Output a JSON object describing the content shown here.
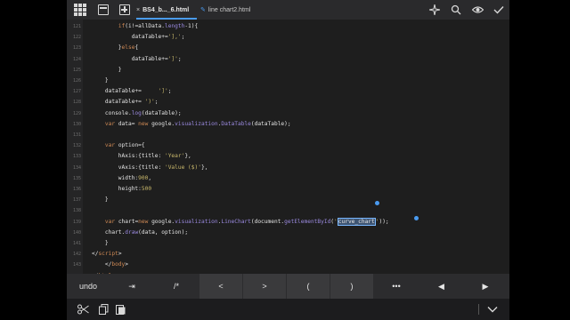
{
  "tabs": [
    {
      "label": "BS4_b..._6.html",
      "active": true
    },
    {
      "label": "line chart2.html",
      "active": false
    }
  ],
  "toolbar": {
    "icons": [
      "grid-icon",
      "folder-icon",
      "plus-icon",
      "sparkle-icon",
      "search-icon",
      "eye-icon",
      "checkmark-icon"
    ],
    "close_glyph": "×",
    "edit_glyph": "✎"
  },
  "editor": {
    "lines": [
      {
        "n": "121",
        "segs": [
          [
            "",
            "        "
          ],
          [
            "kw",
            "if"
          ],
          [
            "",
            "(i!=allData."
          ],
          [
            "fn",
            "length"
          ],
          [
            "",
            "-1){"
          ]
        ]
      },
      {
        "n": "122",
        "segs": [
          [
            "",
            "            dataTable+="
          ],
          [
            "str",
            "'],'"
          ],
          [
            "",
            ";"
          ]
        ]
      },
      {
        "n": "123",
        "segs": [
          [
            "",
            "        }"
          ],
          [
            "kw",
            "else"
          ],
          [
            "",
            "{"
          ]
        ]
      },
      {
        "n": "124",
        "segs": [
          [
            "",
            "            dataTable+="
          ],
          [
            "str",
            "']'"
          ],
          [
            "",
            ";"
          ]
        ]
      },
      {
        "n": "125",
        "segs": [
          [
            "",
            "        }"
          ]
        ]
      },
      {
        "n": "126",
        "segs": [
          [
            "",
            "    }"
          ]
        ]
      },
      {
        "n": "127",
        "segs": [
          [
            "",
            "    dataTable+=     "
          ],
          [
            "str",
            "']'"
          ],
          [
            "",
            ";"
          ]
        ]
      },
      {
        "n": "128",
        "segs": [
          [
            "",
            "    dataTable+= "
          ],
          [
            "str",
            "')'"
          ],
          [
            "",
            ";"
          ]
        ]
      },
      {
        "n": "129",
        "segs": [
          [
            "",
            "    console."
          ],
          [
            "fn",
            "log"
          ],
          [
            "",
            "(dataTable);"
          ]
        ]
      },
      {
        "n": "130",
        "segs": [
          [
            "",
            "    "
          ],
          [
            "kw",
            "var"
          ],
          [
            "",
            " data= "
          ],
          [
            "kw",
            "new"
          ],
          [
            "",
            " google."
          ],
          [
            "fn",
            "visualization"
          ],
          [
            "",
            "."
          ],
          [
            "fn",
            "DataTable"
          ],
          [
            "",
            "(dataTable);"
          ]
        ]
      },
      {
        "n": "131",
        "segs": [
          [
            "",
            ""
          ]
        ]
      },
      {
        "n": "132",
        "segs": [
          [
            "",
            "    "
          ],
          [
            "kw",
            "var"
          ],
          [
            "",
            " option={"
          ]
        ]
      },
      {
        "n": "133",
        "segs": [
          [
            "",
            "        hAxis:{title: "
          ],
          [
            "str",
            "'Year'"
          ],
          [
            "",
            "},"
          ]
        ]
      },
      {
        "n": "134",
        "segs": [
          [
            "",
            "        vAxis:{title: "
          ],
          [
            "str",
            "'Value ($)'"
          ],
          [
            "",
            "},"
          ]
        ]
      },
      {
        "n": "135",
        "segs": [
          [
            "",
            "        width:"
          ],
          [
            "num",
            "900"
          ],
          [
            "",
            ","
          ]
        ]
      },
      {
        "n": "136",
        "segs": [
          [
            "",
            "        height:"
          ],
          [
            "num",
            "500"
          ]
        ]
      },
      {
        "n": "137",
        "segs": [
          [
            "",
            "    }"
          ]
        ]
      },
      {
        "n": "138",
        "segs": [
          [
            "",
            ""
          ]
        ]
      },
      {
        "n": "139",
        "segs": [
          [
            "",
            "    "
          ],
          [
            "kw",
            "var"
          ],
          [
            "",
            " chart="
          ],
          [
            "kw",
            "new"
          ],
          [
            "",
            " google."
          ],
          [
            "fn",
            "visualization"
          ],
          [
            "",
            "."
          ],
          [
            "fn",
            "LineChart"
          ],
          [
            "",
            "(document."
          ],
          [
            "fn",
            "getElementById"
          ],
          [
            "",
            "("
          ],
          [
            "str",
            "'"
          ],
          [
            "sel",
            "curve_chart"
          ],
          [
            "str",
            "'"
          ],
          [
            "",
            "));"
          ]
        ]
      },
      {
        "n": "140",
        "segs": [
          [
            "",
            "    chart."
          ],
          [
            "fn",
            "draw"
          ],
          [
            "",
            "(data, option);"
          ]
        ]
      },
      {
        "n": "141",
        "segs": [
          [
            "",
            "    }"
          ]
        ]
      },
      {
        "n": "142",
        "segs": [
          [
            "",
            "</"
          ],
          [
            "kw",
            "script"
          ],
          [
            "",
            ">"
          ]
        ]
      },
      {
        "n": "143",
        "segs": [
          [
            "",
            "    </"
          ],
          [
            "kw",
            "body"
          ],
          [
            "",
            ">"
          ]
        ]
      },
      {
        "n": "144",
        "segs": [
          [
            "",
            "</"
          ],
          [
            "kw",
            "html"
          ],
          [
            "",
            ">"
          ]
        ]
      },
      {
        "n": "145",
        "segs": [
          [
            "",
            ""
          ]
        ]
      }
    ]
  },
  "keybar": {
    "undo": "undo",
    "tab": "⇥",
    "comment": "/*",
    "lt": "<",
    "gt": ">",
    "lp": "(",
    "rp": ")",
    "more": "•••",
    "left": "◀",
    "right": "▶"
  },
  "bottom": {
    "icons": [
      "scissors-icon",
      "copy-icon",
      "paste-icon",
      "chevron-down-icon"
    ],
    "cut": "✂",
    "copy": "⧉",
    "paste": "📋",
    "hide": "⌄"
  }
}
